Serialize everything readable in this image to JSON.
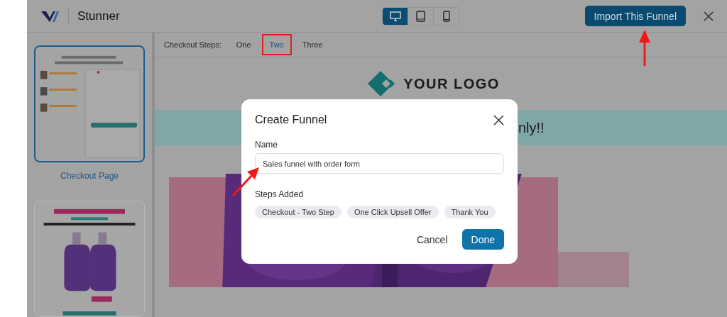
{
  "app": {
    "title": "Stunner",
    "import_button": "Import This Funnel",
    "devices": [
      {
        "kind": "desktop",
        "selected": true
      },
      {
        "kind": "tablet",
        "selected": false
      },
      {
        "kind": "mobile",
        "selected": false
      }
    ]
  },
  "steps_bar": {
    "label": "Checkout Steps:",
    "steps": [
      {
        "label": "One",
        "selected": false
      },
      {
        "label": "Two",
        "selected": true
      },
      {
        "label": "Three",
        "selected": false
      }
    ]
  },
  "sidebar": {
    "templates": [
      {
        "kind": "picture",
        "label": "Checkout Page",
        "selected": true
      },
      {
        "kind": "picture",
        "selected": false
      }
    ]
  },
  "preview": {
    "logo": "YOUR LOGO",
    "banner": "nly!!"
  },
  "dialog": {
    "title": "Create Funnel",
    "name_label": "Name",
    "name_value": "Sales funnel with order form",
    "steps_label": "Steps Added",
    "steps": [
      "Checkout - Two Step",
      "One Click Upsell Offer",
      "Thank You"
    ],
    "buttons": [
      {
        "label": "Cancel",
        "kind": "secondary"
      },
      {
        "label": "Done",
        "kind": "primary"
      }
    ]
  }
}
